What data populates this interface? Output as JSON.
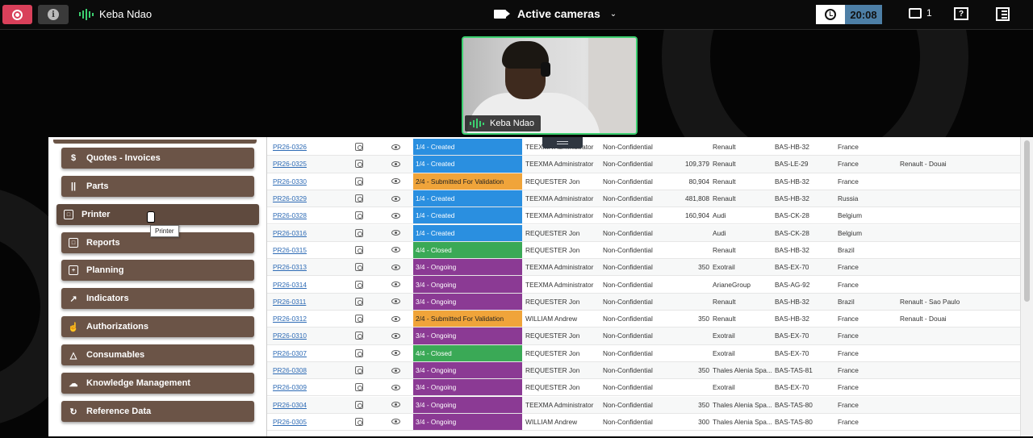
{
  "topbar": {
    "participant_name": "Keba Ndao",
    "view_label": "Active cameras",
    "timer": "20:08",
    "chat_count": "1",
    "help_glyph": "?"
  },
  "camera_tile": {
    "name": "Keba Ndao"
  },
  "colors": {
    "record": "#d9405a",
    "speaking": "#3cd070",
    "timer": "#4d7fa6",
    "sidebar_button": "#6b5447",
    "status_created": "#2a8fe0",
    "status_validation": "#f0a43a",
    "status_closed": "#3aa956",
    "status_ongoing": "#8b3a94"
  },
  "sidebar": {
    "tooltip": "Printer",
    "items": [
      {
        "label": "Quotes - Invoices",
        "icon": "dollar-icon"
      },
      {
        "label": "Parts",
        "icon": "parts-icon"
      },
      {
        "label": "Printer",
        "icon": "printer-icon"
      },
      {
        "label": "Reports",
        "icon": "report-icon"
      },
      {
        "label": "Planning",
        "icon": "calendar-icon"
      },
      {
        "label": "Indicators",
        "icon": "chart-icon"
      },
      {
        "label": "Authorizations",
        "icon": "thumbs-up-icon"
      },
      {
        "label": "Consumables",
        "icon": "consumable-icon"
      },
      {
        "label": "Knowledge Management",
        "icon": "brain-icon"
      },
      {
        "label": "Reference Data",
        "icon": "refresh-icon"
      }
    ]
  },
  "table": {
    "rows": [
      {
        "id": "PR26-0326",
        "status": "1/4 - Created",
        "status_key": "created",
        "owner": "TEEXMA Administrator",
        "confidentiality": "Non-Confidential",
        "qty": "",
        "customer": "Renault",
        "ref": "BAS-HB-32",
        "country": "France",
        "site": ""
      },
      {
        "id": "PR26-0325",
        "status": "1/4 - Created",
        "status_key": "created",
        "owner": "TEEXMA Administrator",
        "confidentiality": "Non-Confidential",
        "qty": "109,379",
        "customer": "Renault",
        "ref": "BAS-LE-29",
        "country": "France",
        "site": "Renault - Douai"
      },
      {
        "id": "PR26-0330",
        "status": "2/4 - Submitted For Validation",
        "status_key": "validation",
        "owner": "REQUESTER Jon",
        "confidentiality": "Non-Confidential",
        "qty": "80,904",
        "customer": "Renault",
        "ref": "BAS-HB-32",
        "country": "France",
        "site": ""
      },
      {
        "id": "PR26-0329",
        "status": "1/4 - Created",
        "status_key": "created",
        "owner": "TEEXMA Administrator",
        "confidentiality": "Non-Confidential",
        "qty": "481,808",
        "customer": "Renault",
        "ref": "BAS-HB-32",
        "country": "Russia",
        "site": ""
      },
      {
        "id": "PR26-0328",
        "status": "1/4 - Created",
        "status_key": "created",
        "owner": "TEEXMA Administrator",
        "confidentiality": "Non-Confidential",
        "qty": "160,904",
        "customer": "Audi",
        "ref": "BAS-CK-28",
        "country": "Belgium",
        "site": ""
      },
      {
        "id": "PR26-0316",
        "status": "1/4 - Created",
        "status_key": "created",
        "owner": "REQUESTER Jon",
        "confidentiality": "Non-Confidential",
        "qty": "",
        "customer": "Audi",
        "ref": "BAS-CK-28",
        "country": "Belgium",
        "site": ""
      },
      {
        "id": "PR26-0315",
        "status": "4/4 - Closed",
        "status_key": "closed",
        "owner": "REQUESTER Jon",
        "confidentiality": "Non-Confidential",
        "qty": "",
        "customer": "Renault",
        "ref": "BAS-HB-32",
        "country": "Brazil",
        "site": ""
      },
      {
        "id": "PR26-0313",
        "status": "3/4 - Ongoing",
        "status_key": "ongoing",
        "owner": "TEEXMA Administrator",
        "confidentiality": "Non-Confidential",
        "qty": "350",
        "customer": "Exotrail",
        "ref": "BAS-EX-70",
        "country": "France",
        "site": ""
      },
      {
        "id": "PR26-0314",
        "status": "3/4 - Ongoing",
        "status_key": "ongoing",
        "owner": "TEEXMA Administrator",
        "confidentiality": "Non-Confidential",
        "qty": "",
        "customer": "ArianeGroup",
        "ref": "BAS-AG-92",
        "country": "France",
        "site": ""
      },
      {
        "id": "PR26-0311",
        "status": "3/4 - Ongoing",
        "status_key": "ongoing",
        "owner": "REQUESTER Jon",
        "confidentiality": "Non-Confidential",
        "qty": "",
        "customer": "Renault",
        "ref": "BAS-HB-32",
        "country": "Brazil",
        "site": "Renault - Sao Paulo"
      },
      {
        "id": "PR26-0312",
        "status": "2/4 - Submitted For Validation",
        "status_key": "validation",
        "owner": "WILLIAM Andrew",
        "confidentiality": "Non-Confidential",
        "qty": "350",
        "customer": "Renault",
        "ref": "BAS-HB-32",
        "country": "France",
        "site": "Renault - Douai"
      },
      {
        "id": "PR26-0310",
        "status": "3/4 - Ongoing",
        "status_key": "ongoing",
        "owner": "REQUESTER Jon",
        "confidentiality": "Non-Confidential",
        "qty": "",
        "customer": "Exotrail",
        "ref": "BAS-EX-70",
        "country": "France",
        "site": ""
      },
      {
        "id": "PR26-0307",
        "status": "4/4 - Closed",
        "status_key": "closed",
        "owner": "REQUESTER Jon",
        "confidentiality": "Non-Confidential",
        "qty": "",
        "customer": "Exotrail",
        "ref": "BAS-EX-70",
        "country": "France",
        "site": ""
      },
      {
        "id": "PR26-0308",
        "status": "3/4 - Ongoing",
        "status_key": "ongoing",
        "owner": "REQUESTER Jon",
        "confidentiality": "Non-Confidential",
        "qty": "350",
        "customer": "Thales Alenia Spa...",
        "ref": "BAS-TAS-81",
        "country": "France",
        "site": ""
      },
      {
        "id": "PR26-0309",
        "status": "3/4 - Ongoing",
        "status_key": "ongoing",
        "owner": "REQUESTER Jon",
        "confidentiality": "Non-Confidential",
        "qty": "",
        "customer": "Exotrail",
        "ref": "BAS-EX-70",
        "country": "France",
        "site": ""
      },
      {
        "id": "PR26-0304",
        "status": "3/4 - Ongoing",
        "status_key": "ongoing",
        "owner": "TEEXMA Administrator",
        "confidentiality": "Non-Confidential",
        "qty": "350",
        "customer": "Thales Alenia Spa...",
        "ref": "BAS-TAS-80",
        "country": "France",
        "site": ""
      },
      {
        "id": "PR26-0305",
        "status": "3/4 - Ongoing",
        "status_key": "ongoing",
        "owner": "WILLIAM Andrew",
        "confidentiality": "Non-Confidential",
        "qty": "300",
        "customer": "Thales Alenia Spa...",
        "ref": "BAS-TAS-80",
        "country": "France",
        "site": ""
      }
    ]
  }
}
